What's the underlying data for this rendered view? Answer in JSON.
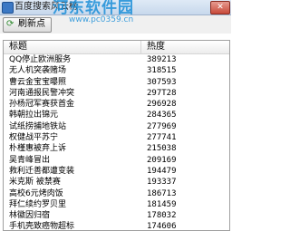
{
  "window": {
    "title": "百度搜索风云榜",
    "close_label": "✕"
  },
  "watermark": {
    "text": "河东软件园",
    "url": "www.pc0359.cn"
  },
  "toolbar": {
    "refresh_label": "刷新点"
  },
  "table": {
    "columns": [
      "标题",
      "热度"
    ],
    "rows": [
      {
        "title": "QQ停止欧洲服务",
        "heat": "389213"
      },
      {
        "title": "无人机突袭赌场",
        "heat": "318515"
      },
      {
        "title": "曹云金宝宝曝照",
        "heat": "307593"
      },
      {
        "title": "河南通报民警冲突",
        "heat": "297T28"
      },
      {
        "title": "孙杨冠军赛获首金",
        "heat": "296928"
      },
      {
        "title": "韩朝拉出锦元",
        "heat": "284365"
      },
      {
        "title": "试纸捞捕地铁站",
        "heat": "277969"
      },
      {
        "title": "权健战平苏宁",
        "heat": "277741"
      },
      {
        "title": "朴槿惠被弃上诉",
        "heat": "215038"
      },
      {
        "title": "吴青峰冒出",
        "heat": "209169"
      },
      {
        "title": "救利迁善都遭变装",
        "heat": "194479"
      },
      {
        "title": "米克斯 被禁赛",
        "heat": "193337"
      },
      {
        "title": "高校6元烤肉饭",
        "heat": "186713"
      },
      {
        "title": "拜仁续约罗贝里",
        "heat": "181459"
      },
      {
        "title": "林徽因归宿",
        "heat": "178032"
      },
      {
        "title": "手机壳致癌物超标",
        "heat": "174606"
      }
    ]
  }
}
